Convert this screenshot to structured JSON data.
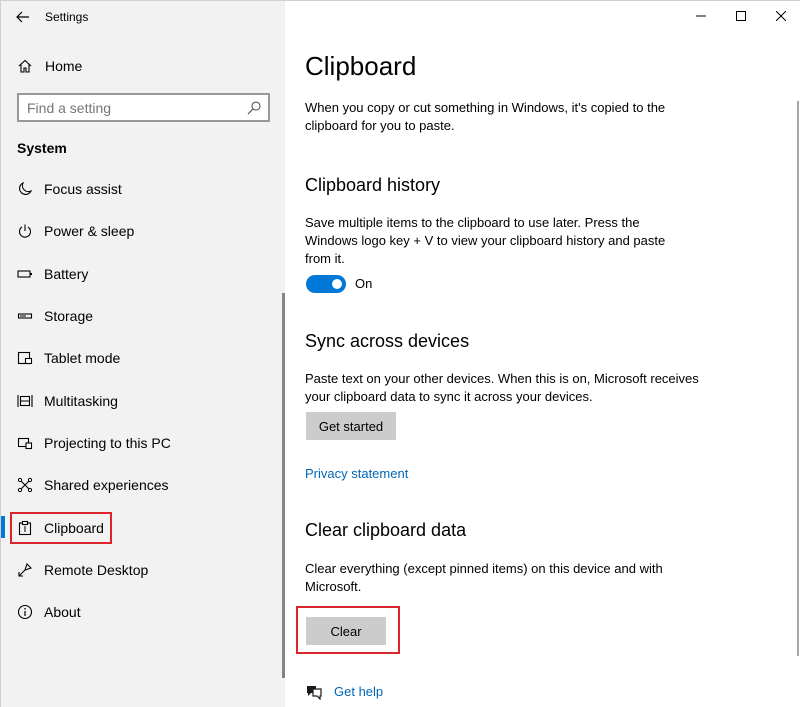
{
  "window": {
    "title": "Settings"
  },
  "sidebar": {
    "home_label": "Home",
    "search_placeholder": "Find a setting",
    "section_label": "System",
    "items": [
      {
        "label": "Focus assist",
        "icon": "moon-icon"
      },
      {
        "label": "Power & sleep",
        "icon": "power-icon"
      },
      {
        "label": "Battery",
        "icon": "battery-icon"
      },
      {
        "label": "Storage",
        "icon": "storage-icon"
      },
      {
        "label": "Tablet mode",
        "icon": "tablet-icon"
      },
      {
        "label": "Multitasking",
        "icon": "multitasking-icon"
      },
      {
        "label": "Projecting to this PC",
        "icon": "projecting-icon"
      },
      {
        "label": "Shared experiences",
        "icon": "shared-icon"
      },
      {
        "label": "Clipboard",
        "icon": "clipboard-icon",
        "active": true
      },
      {
        "label": "Remote Desktop",
        "icon": "remote-desktop-icon"
      },
      {
        "label": "About",
        "icon": "info-icon"
      }
    ]
  },
  "main": {
    "title": "Clipboard",
    "intro": "When you copy or cut something in Windows, it's copied to the clipboard for you to paste.",
    "history": {
      "heading": "Clipboard history",
      "description": "Save multiple items to the clipboard to use later. Press the Windows logo key + V to view your clipboard history and paste from it.",
      "toggle_state": "On"
    },
    "sync": {
      "heading": "Sync across devices",
      "description": "Paste text on your other devices. When this is on, Microsoft receives your clipboard data to sync it across your devices.",
      "button_label": "Get started",
      "privacy_link": "Privacy statement"
    },
    "clear": {
      "heading": "Clear clipboard data",
      "description": "Clear everything (except pinned items) on this device and with Microsoft.",
      "button_label": "Clear"
    },
    "help_link": "Get help"
  },
  "colors": {
    "accent": "#0078d7",
    "link": "#0067b8",
    "highlight": "#d9252b"
  }
}
